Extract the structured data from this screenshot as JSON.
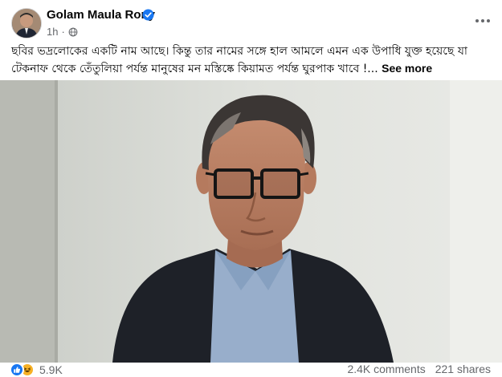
{
  "post": {
    "author": "Golam Maula Rony",
    "time": "1h",
    "separator": "·",
    "text": "ছবির ভদ্রলোকের একটি নাম আছে। কিন্তু তার নামের সঙ্গে হাল আমলে এমন এক উপাধি যুক্ত হয়েছে যা টেকনাফ থেকে তেঁতুলিয়া পর্যন্ত মানুষের মন মস্তিষ্কে কিয়ামত পর্যন্ত ঘুরপাক খাবে !...",
    "see_more": "See more"
  },
  "reactions": {
    "count": "5.9K",
    "comments": "2.4K comments",
    "shares": "221 shares"
  },
  "icons": {
    "verified": "verified-badge-icon",
    "audience": "globe-icon",
    "menu": "more-options-icon",
    "like": "like-reaction-icon",
    "haha": "haha-reaction-icon"
  },
  "colors": {
    "verified": "#1877f2",
    "secondary_text": "#65676b",
    "like": "#1877f2",
    "haha": "#f7b125"
  }
}
